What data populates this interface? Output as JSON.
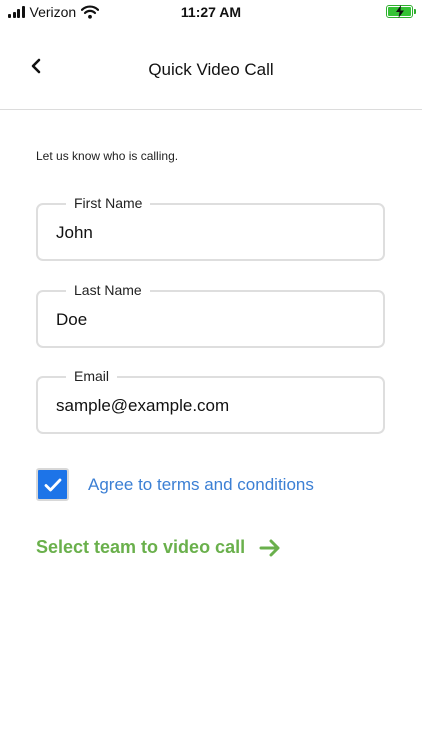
{
  "status_bar": {
    "carrier": "Verizon",
    "time": "11:27 AM",
    "signal_icon": "signal-bars-icon",
    "wifi_icon": "wifi-icon",
    "battery_icon": "battery-charging-icon"
  },
  "header": {
    "title": "Quick Video Call",
    "back_icon": "chevron-left-icon"
  },
  "form": {
    "intro": "Let us know who is calling.",
    "first_name": {
      "label": "First Name",
      "value": "John"
    },
    "last_name": {
      "label": "Last Name",
      "value": "Doe"
    },
    "email": {
      "label": "Email",
      "value": "sample@example.com"
    },
    "agree": {
      "label": "Agree to terms and conditions",
      "checked": true
    },
    "cta": {
      "label": "Select team to video call",
      "icon": "arrow-right-icon"
    }
  },
  "colors": {
    "checkbox": "#1d74e8",
    "agree_text": "#3b7fd4",
    "cta": "#6ab04c",
    "battery": "#35c235",
    "field_border": "#dedede"
  }
}
